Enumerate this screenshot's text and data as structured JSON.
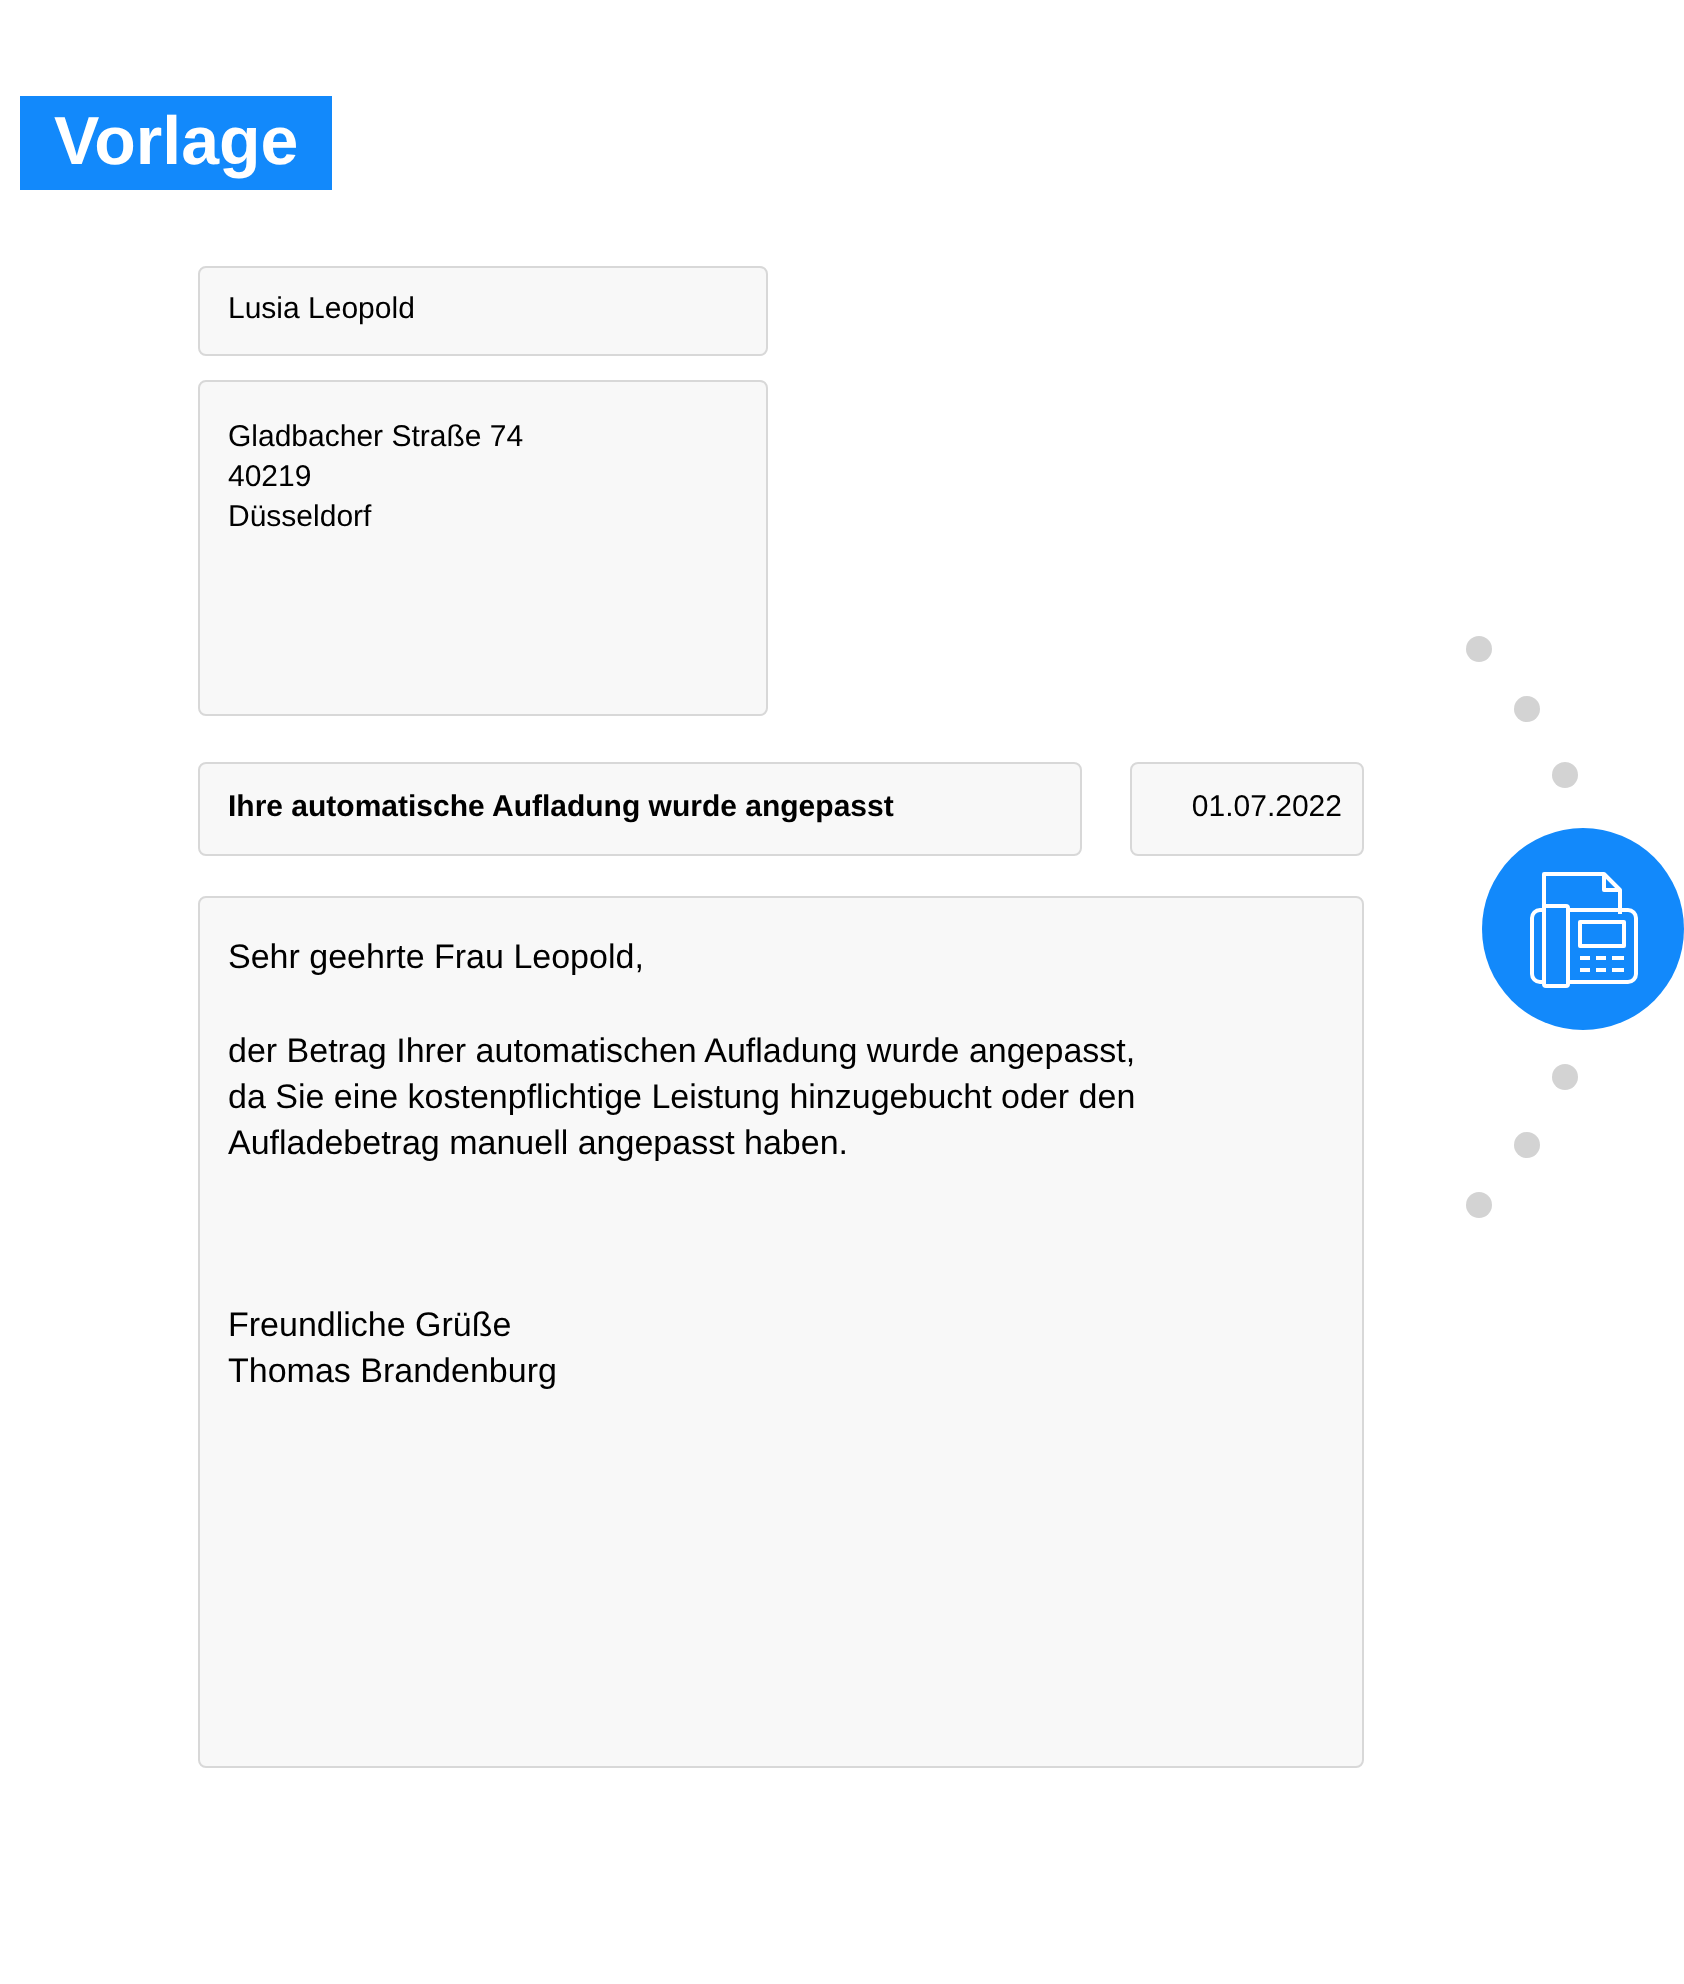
{
  "heading": "Vorlage",
  "recipient": {
    "name": "Lusia Leopold",
    "address_lines": [
      "Gladbacher Straße 74",
      "40219",
      "Düsseldorf"
    ]
  },
  "subject": "Ihre automatische Aufladung wurde angepasst",
  "date": "01.07.2022",
  "body": {
    "paragraphs": [
      [
        "Sehr geehrte Frau Leopold,"
      ],
      [
        "der Betrag Ihrer automatischen Aufladung wurde angepasst,",
        "da Sie eine kostenpflichtige Leistung hinzugebucht oder den",
        "Aufladebetrag manuell angepasst haben."
      ],
      [
        "Freundliche Grüße",
        "Thomas Brandenburg"
      ]
    ]
  }
}
